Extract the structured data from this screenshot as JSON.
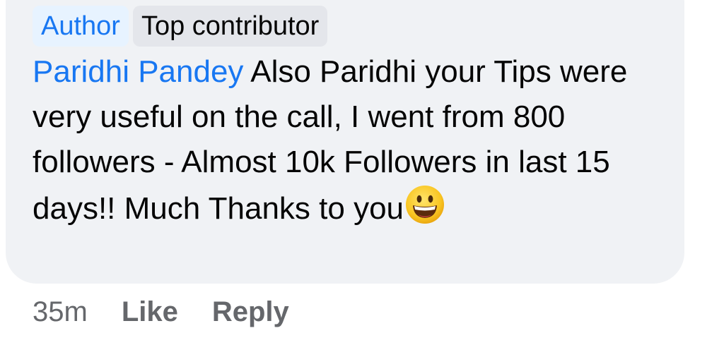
{
  "badges": {
    "author": "Author",
    "top_contributor": "Top contributor"
  },
  "comment": {
    "mention": "Paridhi Pandey",
    "text": " Also Paridhi your Tips were very useful on the call, I went from 800 followers - Almost 10k Followers in last 15 days!! Much Thanks to you",
    "emoji": "grinning-face-icon"
  },
  "actions": {
    "timestamp": "35m",
    "like": "Like",
    "reply": "Reply"
  },
  "colors": {
    "bubble_background": "#f0f2f5",
    "link_blue": "#1877f2",
    "text_primary": "#050505",
    "text_secondary": "#65676b"
  }
}
